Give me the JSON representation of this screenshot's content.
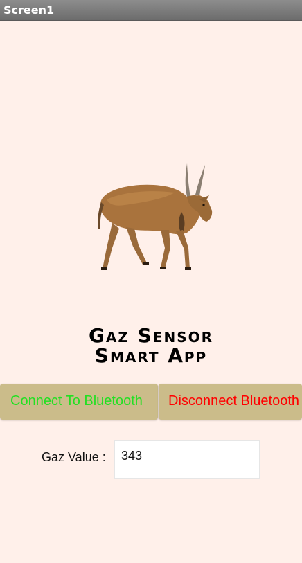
{
  "window": {
    "title": "Screen1"
  },
  "app": {
    "title_line1": "Gaz Sensor",
    "title_line2": "Smart App"
  },
  "buttons": {
    "connect_label": "Connect To Bluetooth",
    "disconnect_label": "Disconnect Bluetooth"
  },
  "gaz": {
    "label": "Gaz Value :",
    "value": "343"
  },
  "colors": {
    "background": "#fff0ea",
    "button_bg": "#cbbc8a",
    "connect_text": "#22e022",
    "disconnect_text": "#ff0000"
  },
  "image": {
    "subject": "eland-antelope-image"
  }
}
